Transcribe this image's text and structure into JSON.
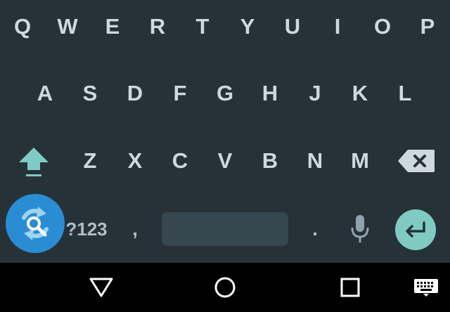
{
  "keyboard": {
    "row1": [
      "Q",
      "W",
      "E",
      "R",
      "T",
      "Y",
      "U",
      "I",
      "O",
      "P"
    ],
    "row2": [
      "A",
      "S",
      "D",
      "F",
      "G",
      "H",
      "J",
      "K",
      "L"
    ],
    "row3": [
      "Z",
      "X",
      "C",
      "V",
      "B",
      "N",
      "M"
    ],
    "num_label": "?123",
    "comma_label": ",",
    "period_label": ".",
    "accent_color": "#7FCBC4",
    "key_text_color": "#CFD8DC",
    "background_color": "#263238"
  },
  "icons": {
    "shift": "shift-icon",
    "backspace": "backspace-icon",
    "microphone": "microphone-icon",
    "enter": "enter-icon",
    "overlay": "overlay-app-icon",
    "back": "back-icon",
    "home": "home-icon",
    "recents": "recents-icon",
    "keyboard_switch": "keyboard-switch-icon"
  }
}
